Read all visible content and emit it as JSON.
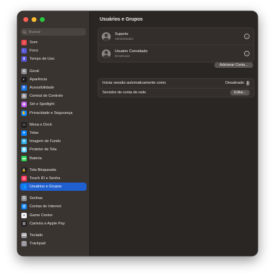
{
  "search": {
    "placeholder": "Buscar"
  },
  "sidebar": {
    "items": [
      {
        "label": "Som",
        "icon": "speaker-icon",
        "color": "#e5484d",
        "glyph": "♪"
      },
      {
        "label": "Foco",
        "icon": "moon-icon",
        "color": "#5856d6",
        "glyph": "☾"
      },
      {
        "label": "Tempo de Uso",
        "icon": "hourglass-icon",
        "color": "#5856d6",
        "glyph": "⧗"
      },
      {
        "label": "Geral",
        "icon": "gear-icon",
        "color": "#8e8e93",
        "glyph": "⚙"
      },
      {
        "label": "Aparência",
        "icon": "appearance-icon",
        "color": "#1c1c1e",
        "glyph": "◐"
      },
      {
        "label": "Acessibilidade",
        "icon": "accessibility-icon",
        "color": "#0a84ff",
        "glyph": "♿"
      },
      {
        "label": "Central de Controle",
        "icon": "control-center-icon",
        "color": "#8e8e93",
        "glyph": "▤"
      },
      {
        "label": "Siri e Spotlight",
        "icon": "siri-icon",
        "color": "#bf5af2",
        "glyph": "◉"
      },
      {
        "label": "Privacidade e Segurança",
        "icon": "hand-icon",
        "color": "#0a84ff",
        "glyph": "✋"
      },
      {
        "label": "Mesa e Dock",
        "icon": "dock-icon",
        "color": "#1c1c1e",
        "glyph": "▭"
      },
      {
        "label": "Telas",
        "icon": "display-icon",
        "color": "#0a84ff",
        "glyph": "✷"
      },
      {
        "label": "Imagem de Fundo",
        "icon": "wallpaper-icon",
        "color": "#32ade6",
        "glyph": "❀"
      },
      {
        "label": "Protetor de Tela",
        "icon": "screensaver-icon",
        "color": "#64d2ff",
        "glyph": "▣"
      },
      {
        "label": "Bateria",
        "icon": "battery-icon",
        "color": "#30d158",
        "glyph": "▬"
      },
      {
        "label": "Tela Bloqueada",
        "icon": "lock-icon",
        "color": "#1c1c1e",
        "glyph": "🔒"
      },
      {
        "label": "Touch ID e Senha",
        "icon": "fingerprint-icon",
        "color": "#ff375f",
        "glyph": "◎"
      },
      {
        "label": "Usuários e Grupos",
        "icon": "users-icon",
        "color": "#0a84ff",
        "glyph": "👥"
      },
      {
        "label": "Senhas",
        "icon": "key-icon",
        "color": "#8e8e93",
        "glyph": "⚿"
      },
      {
        "label": "Contas de Internet",
        "icon": "at-icon",
        "color": "#0a84ff",
        "glyph": "@"
      },
      {
        "label": "Game Center",
        "icon": "game-center-icon",
        "color": "#f2f2f7",
        "glyph": "●"
      },
      {
        "label": "Carteira e Apple Pay",
        "icon": "wallet-icon",
        "color": "#1c1c1e",
        "glyph": "▥"
      },
      {
        "label": "Teclado",
        "icon": "keyboard-icon",
        "color": "#8e8e93",
        "glyph": "⌨"
      },
      {
        "label": "Trackpad",
        "icon": "trackpad-icon",
        "color": "#8e8e93",
        "glyph": "▢"
      }
    ]
  },
  "main": {
    "title": "Usuários e Grupos",
    "users": [
      {
        "name": "Suporte",
        "role": "Administrador"
      },
      {
        "name": "Usuário Convidado",
        "role": "Desativado"
      }
    ],
    "add_account_label": "Adicionar Conta...",
    "auto_login_label": "Iniciar sessão automaticamente como",
    "auto_login_value": "Desativado",
    "network_server_label": "Servidor de conta de rede",
    "edit_label": "Editar...",
    "help_label": "?"
  }
}
